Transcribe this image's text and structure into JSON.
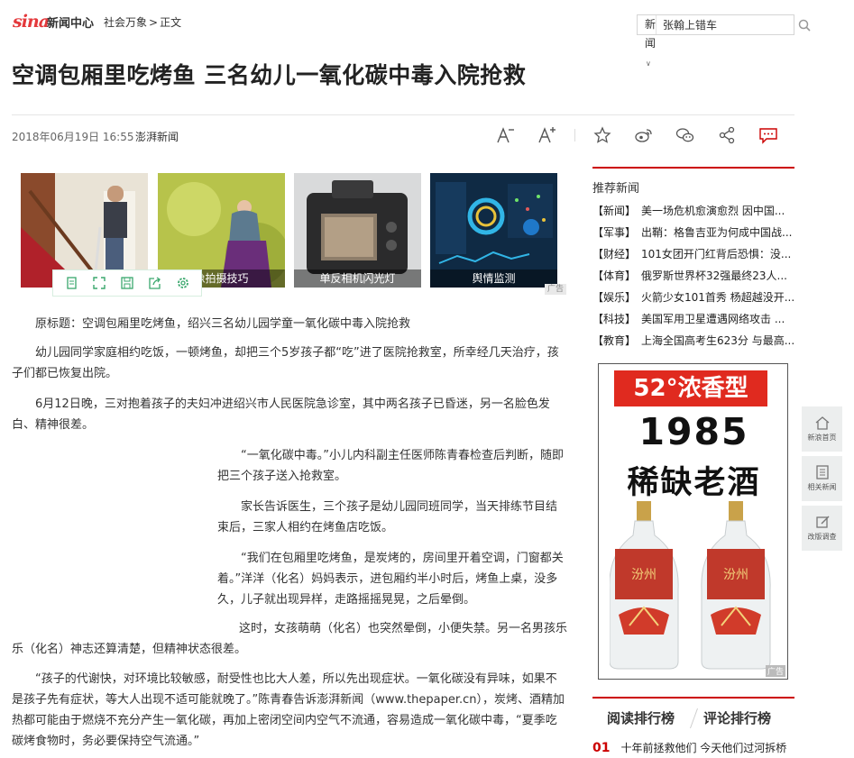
{
  "header": {
    "logo_text": "sina",
    "logo_sub": "新闻中心",
    "breadcrumb": [
      "社会万象",
      ">",
      "正文"
    ],
    "search_select": "新闻",
    "search_value": "张翰上错车"
  },
  "article": {
    "title": "空调包厢里吃烤鱼 三名幼儿一氧化碳中毒入院抢救",
    "date": "2018年06月19日 16:55",
    "source": "澎湃新闻",
    "paragraphs": [
      "原标题：空调包厢里吃烤鱼，绍兴三名幼儿园学童一氧化碳中毒入院抢救",
      "幼儿园同学家庭相约吃饭，一顿烤鱼，却把三个5岁孩子都“吃”进了医院抢救室，所幸经几天治疗，孩子们都已恢复出院。",
      "6月12日晚，三对抱着孩子的夫妇冲进绍兴市人民医院急诊室，其中两名孩子已昏迷，另一名脸色发白、精神很差。",
      "“一氧化碳中毒。”小儿内科副主任医师陈青春检查后判断，随即把三个孩子送入抢救室。",
      "家长告诉医生，三个孩子是幼儿园同班同学，当天排练节目结束后，三家人相约在烤鱼店吃饭。",
      "“我们在包厢里吃烤鱼，是炭烤的，房间里开着空调，门窗都关着。”洋洋（化名）妈妈表示，进包厢约半小时后，烤鱼上桌，没多久，儿子就出现异样，走路摇摇晃晃，之后晕倒。",
      "这时，女孩萌萌（化名）也突然晕倒，小便失禁。另一名男孩乐乐（化名）神志还算清楚，但精神状态很差。",
      "“孩子的代谢快，对环境比较敏感，耐受性也比大人差，所以先出现症状。一氧化碳没有异味，如果不是孩子先有症状，等大人出现不适可能就晚了。”陈青春告诉澎湃新闻（www.thepaper.cn），炭烤、酒精加热都可能由于燃烧不充分产生一氧化碳，再加上密闭空间内空气不流通，容易造成一氧化碳中毒，“夏季吃碳烤食物时，务必要保持空气流通。”"
    ]
  },
  "image_ads": [
    {
      "caption": ""
    },
    {
      "caption": "像拍摄技巧"
    },
    {
      "caption": "单反相机闪光灯"
    },
    {
      "caption": "舆情监测"
    }
  ],
  "ad_tag": "广告",
  "recommend": {
    "title": "推荐新闻",
    "items": [
      {
        "cat": "【新闻】",
        "text": "美一场危机愈演愈烈 因中国..."
      },
      {
        "cat": "【军事】",
        "text": "出鞘：格鲁吉亚为何成中国战..."
      },
      {
        "cat": "【财经】",
        "text": "101女团开门红背后恐惧：没..."
      },
      {
        "cat": "【体育】",
        "text": "俄罗斯世界杯32强最终23人..."
      },
      {
        "cat": "【娱乐】",
        "text": "火箭少女101首秀 杨超越没开..."
      },
      {
        "cat": "【科技】",
        "text": "美国军用卫星遭遇网络攻击 ..."
      },
      {
        "cat": "【教育】",
        "text": "上海全国高考生623分 与最高..."
      }
    ]
  },
  "big_ad": {
    "banner": "52°浓香型",
    "year": "1985",
    "sub": "稀缺老酒",
    "bottle_label": "汾州"
  },
  "ranking": {
    "tabs": [
      "阅读排行榜",
      "评论排行榜"
    ],
    "items": [
      {
        "num": "01",
        "text": "十年前拯救他们 今天他们过河拆桥"
      }
    ]
  },
  "side_float": [
    "新浪首页",
    "相关新闻",
    "改版调查"
  ]
}
